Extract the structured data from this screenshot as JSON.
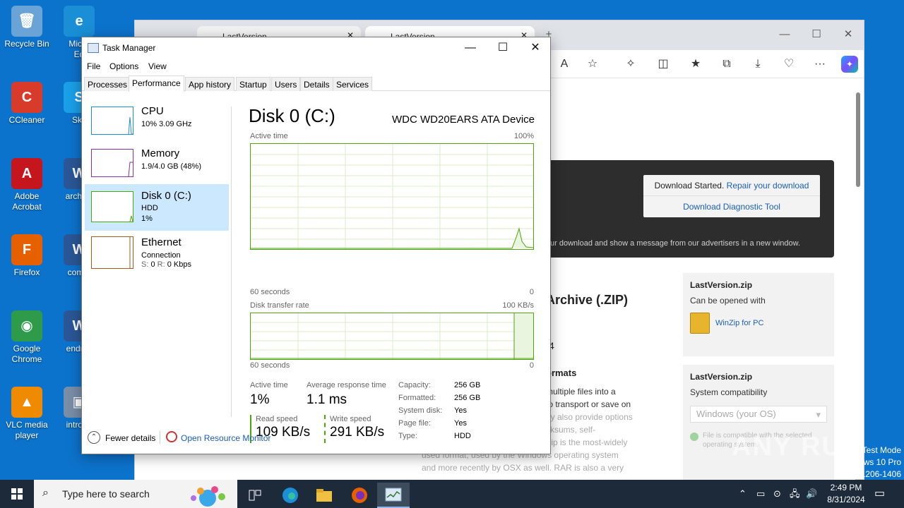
{
  "desktop": {
    "icons": [
      {
        "label": "Recycle Bin",
        "name": "recycle-bin-icon",
        "color": "#6aa3d6",
        "glyph": "🗑"
      },
      {
        "label": "Micro\nEd",
        "name": "edge-desktop-icon",
        "color": "#1a8fd6",
        "glyph": "e"
      },
      {
        "label": "CCleaner",
        "name": "ccleaner-icon",
        "color": "#d93b2b",
        "glyph": "C"
      },
      {
        "label": "Sky",
        "name": "skype-icon",
        "color": "#1aa0e8",
        "glyph": "S"
      },
      {
        "label": "Adobe\nAcrobat",
        "name": "acrobat-icon",
        "color": "#c4161c",
        "glyph": "A"
      },
      {
        "label": "archive",
        "name": "word-doc-archive-icon",
        "color": "#2b5797",
        "glyph": "W"
      },
      {
        "label": "Firefox",
        "name": "firefox-icon",
        "color": "#e66000",
        "glyph": "F"
      },
      {
        "label": "comm",
        "name": "word-doc-comm-icon",
        "color": "#2b5797",
        "glyph": "W"
      },
      {
        "label": "Google\nChrome",
        "name": "chrome-icon",
        "color": "#2e9b4b",
        "glyph": "◉"
      },
      {
        "label": "endrev",
        "name": "word-doc-endrev-icon",
        "color": "#2b5797",
        "glyph": "W"
      },
      {
        "label": "VLC media\nplayer",
        "name": "vlc-icon",
        "color": "#f08a00",
        "glyph": "▲"
      },
      {
        "label": "introdu",
        "name": "image-introdu-icon",
        "color": "#7a8ea8",
        "glyph": "▣"
      }
    ]
  },
  "browser": {
    "tabs": [
      "LastVersion",
      "LastVersion"
    ],
    "banner_message": "ur download and show a message from our advertisers in a new window.",
    "download_started": "Download Started.",
    "repair_link": "Repair your download",
    "diagnostic_link": "Download Diagnostic Tool",
    "heading": "Archive (.ZIP)",
    "subheading": "ormats",
    "stray_char": "4",
    "paragraph": [
      "multiple files into a",
      "to transport or save on",
      "ay also provide options",
      "cksums, self-",
      "Zip is the most-widely",
      "used format, used by the Windows operating system",
      "and more recently by OSX as well. RAR is also a very"
    ],
    "card1": {
      "title": "LastVersion.zip",
      "sub": "Can be opened with",
      "app": "WinZip for PC"
    },
    "card2": {
      "title": "LastVersion.zip",
      "sub": "System compatibility",
      "select": "Windows (your OS)",
      "compat": "File is compatible with the selected operating system."
    }
  },
  "task_manager": {
    "title": "Task Manager",
    "menu": [
      "File",
      "Options",
      "View"
    ],
    "tabs": [
      "Processes",
      "Performance",
      "App history",
      "Startup",
      "Users",
      "Details",
      "Services"
    ],
    "selected_tab": "Performance",
    "resources": [
      {
        "name": "CPU",
        "sub": "10%  3.09 GHz",
        "color": "#1a8fd6"
      },
      {
        "name": "Memory",
        "sub": "1.9/4.0 GB (48%)",
        "color": "#8b2ea8"
      },
      {
        "name": "Disk 0 (C:)",
        "sub": "HDD\n1%",
        "color": "#4da60c"
      },
      {
        "name": "Ethernet",
        "sub": "Connection",
        "color": "#a85a1a"
      }
    ],
    "ethernet_speed": {
      "s_label": "S:",
      "s_val": "0",
      "r_label": "R:",
      "r_val": "0 Kbps"
    },
    "disk": {
      "title": "Disk 0 (C:)",
      "device": "WDC WD20EARS ATA Device",
      "active_label": "Active time",
      "active_max": "100%",
      "sixty": "60 seconds",
      "zero": "0",
      "transfer_label": "Disk transfer rate",
      "transfer_max": "100 KB/s",
      "active_time_label": "Active time",
      "active_time": "1%",
      "resp_label": "Average response time",
      "resp": "1.1 ms",
      "read_label": "Read speed",
      "read": "109 KB/s",
      "write_label": "Write speed",
      "write": "291 KB/s",
      "props": [
        {
          "k": "Capacity:",
          "v": "256 GB"
        },
        {
          "k": "Formatted:",
          "v": "256 GB"
        },
        {
          "k": "System disk:",
          "v": "Yes"
        },
        {
          "k": "Page file:",
          "v": "Yes"
        },
        {
          "k": "Type:",
          "v": "HDD"
        }
      ]
    },
    "fewer_details": "Fewer details",
    "open_resource_monitor": "Open Resource Monitor"
  },
  "watermark": "ANY RUN",
  "test_mode": [
    "Test Mode",
    "ows 10 Pro",
    "1206-1406"
  ],
  "taskbar": {
    "search_placeholder": "Type here to search",
    "time": "2:49 PM",
    "date": "8/31/2024"
  }
}
